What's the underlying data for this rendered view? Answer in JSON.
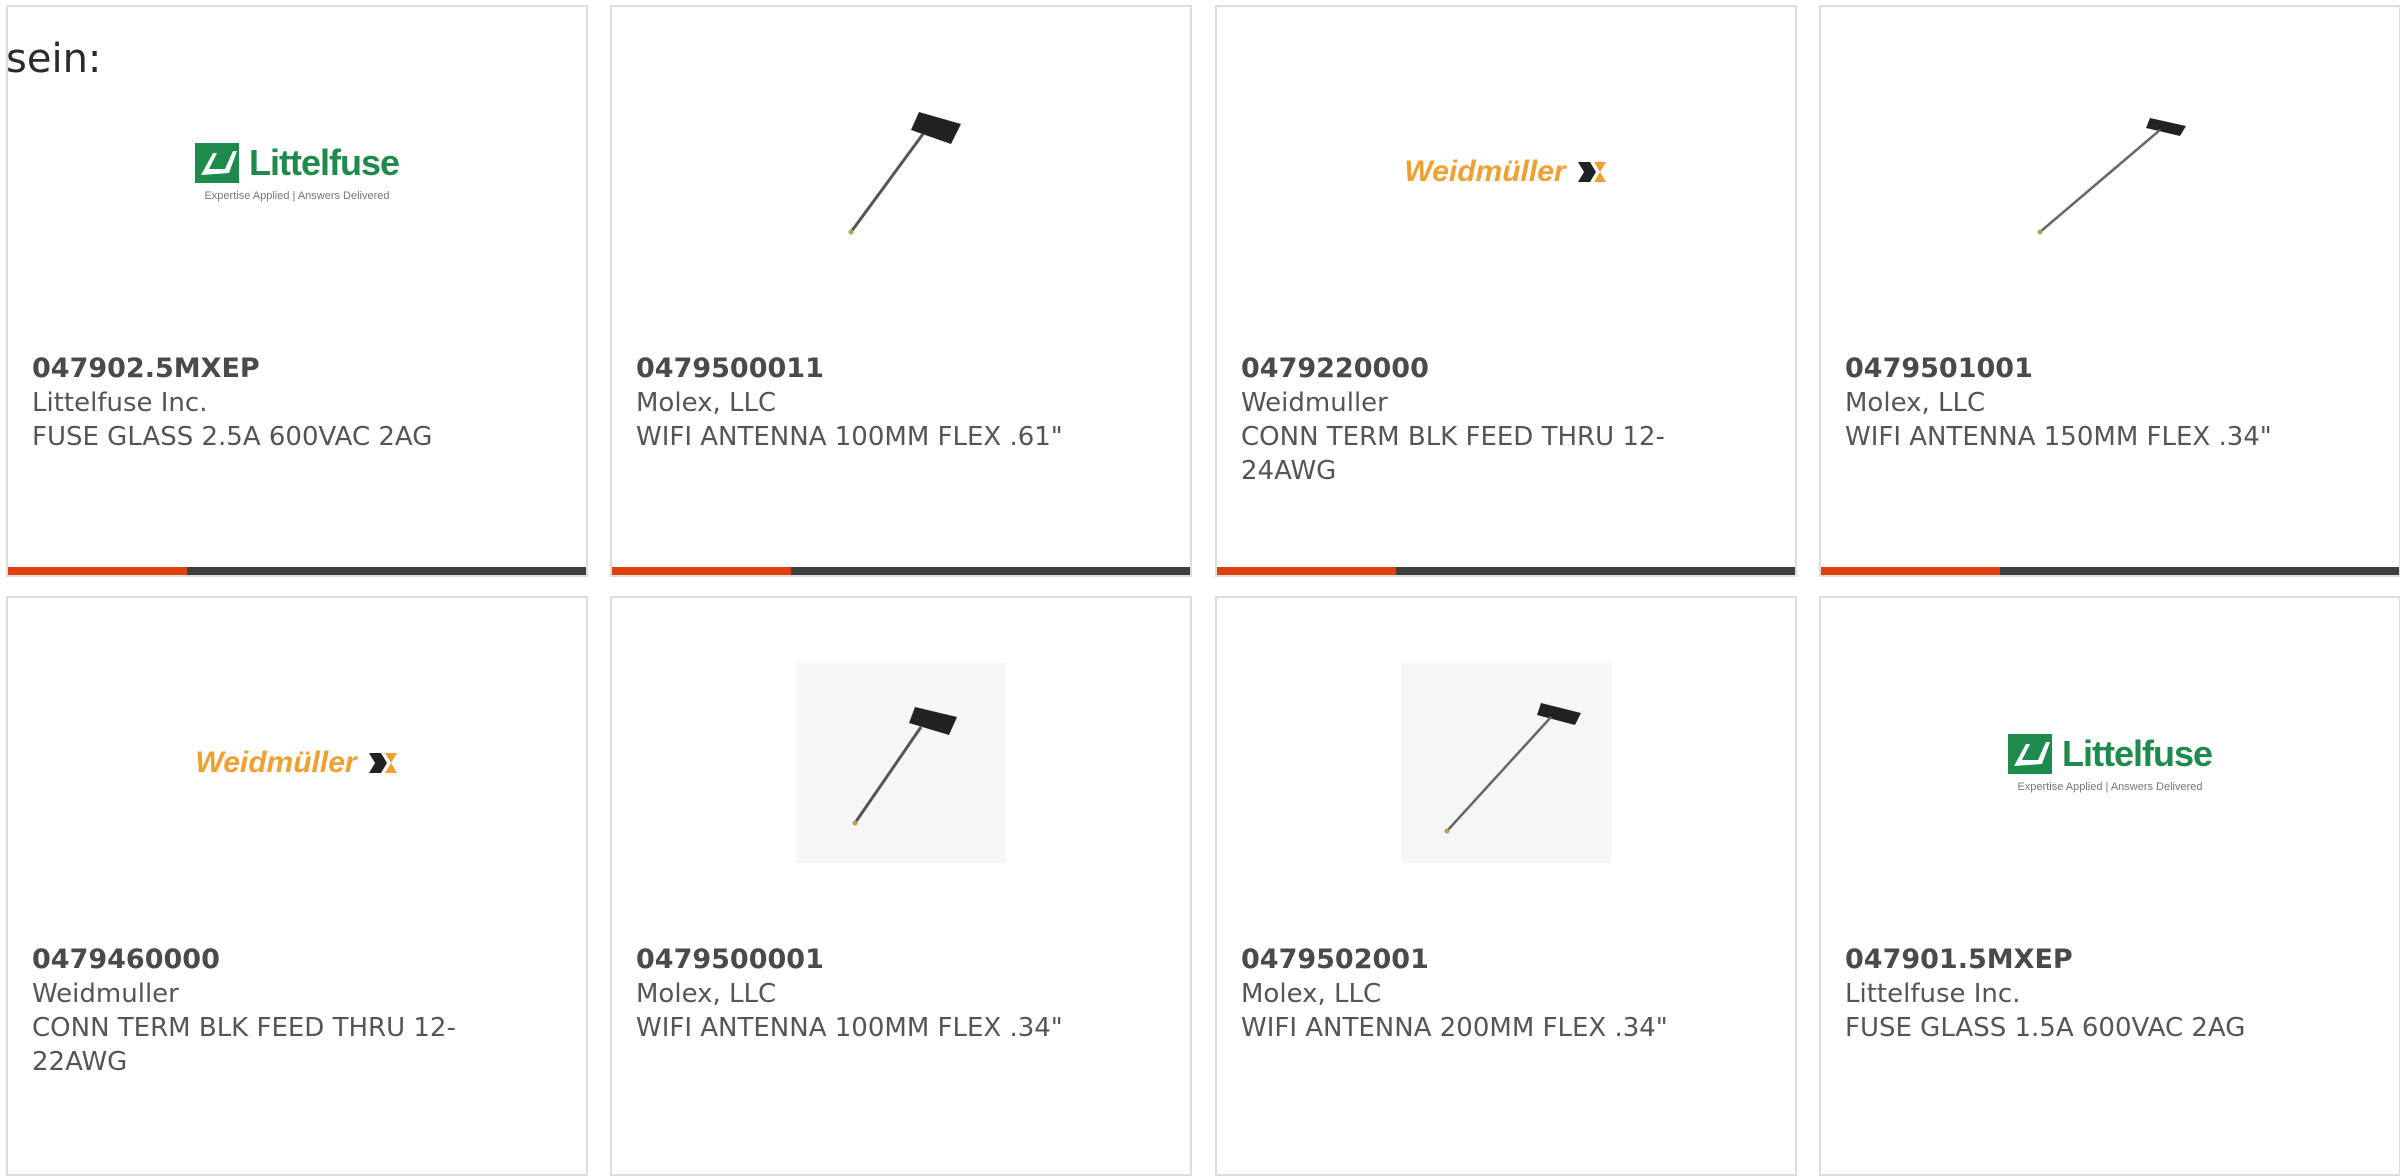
{
  "lead_text": "sein:",
  "colors": {
    "accent": "#e0400f",
    "bar": "#3f3f3f",
    "border": "#dddddd",
    "littelfuse_green": "#1e8a4c",
    "weidmuller_orange": "#f0a030"
  },
  "logos": {
    "littelfuse": {
      "name": "Littelfuse",
      "tagline": "Expertise Applied | Answers Delivered"
    },
    "weidmuller": {
      "name": "Weidmüller"
    }
  },
  "products": [
    {
      "part_number": "047902.5MXEP",
      "manufacturer": "Littelfuse Inc.",
      "description": "FUSE GLASS 2.5A 600VAC 2AG",
      "image": "littelfuse-logo",
      "rating_fraction": 0.31
    },
    {
      "part_number": "0479500011",
      "manufacturer": "Molex, LLC",
      "description": "WIFI ANTENNA 100MM FLEX .61\"",
      "image": "flex-antenna-photo",
      "rating_fraction": 0.31
    },
    {
      "part_number": "0479220000",
      "manufacturer": "Weidmuller",
      "description": "CONN TERM BLK FEED THRU 12-24AWG",
      "image": "weidmuller-logo",
      "rating_fraction": 0.31
    },
    {
      "part_number": "0479501001",
      "manufacturer": "Molex, LLC",
      "description": "WIFI ANTENNA 150MM FLEX .34\"",
      "image": "flex-antenna-photo",
      "rating_fraction": 0.31
    },
    {
      "part_number": "0479460000",
      "manufacturer": "Weidmuller",
      "description": "CONN TERM BLK FEED THRU 12-22AWG",
      "image": "weidmuller-logo"
    },
    {
      "part_number": "0479500001",
      "manufacturer": "Molex, LLC",
      "description": "WIFI ANTENNA 100MM FLEX .34\"",
      "image": "flex-antenna-photo"
    },
    {
      "part_number": "0479502001",
      "manufacturer": "Molex, LLC",
      "description": "WIFI ANTENNA 200MM FLEX .34\"",
      "image": "flex-antenna-photo"
    },
    {
      "part_number": "047901.5MXEP",
      "manufacturer": "Littelfuse Inc.",
      "description": "FUSE GLASS 1.5A 600VAC 2AG",
      "image": "littelfuse-logo"
    }
  ]
}
